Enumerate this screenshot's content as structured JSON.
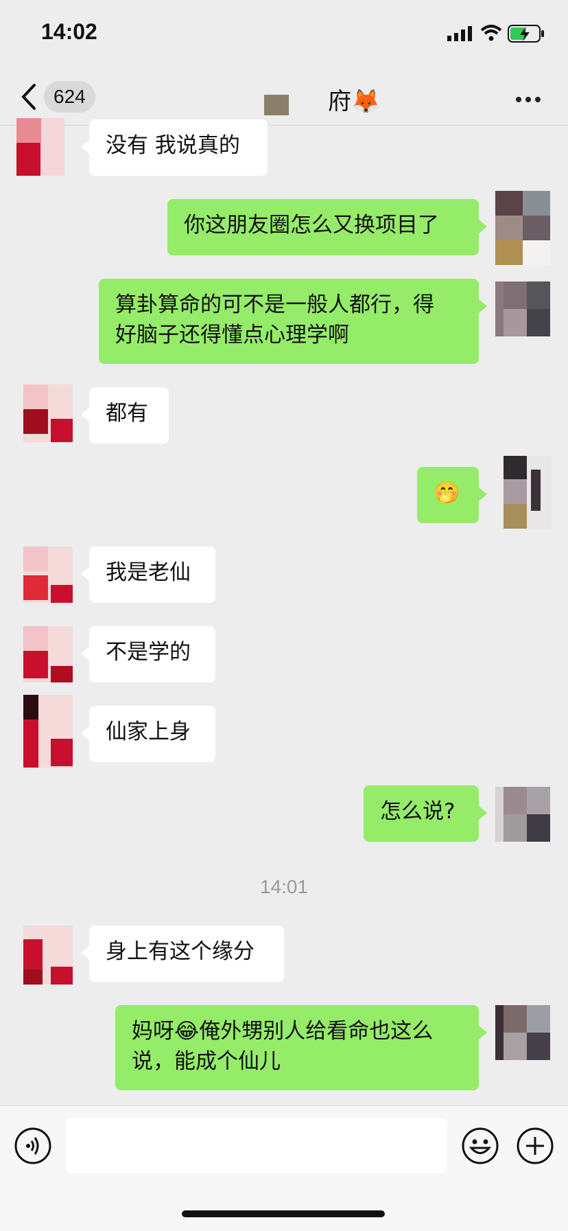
{
  "status_bar": {
    "time": "14:02"
  },
  "nav": {
    "unread_count": "624",
    "title": "府🦊"
  },
  "messages": [
    {
      "side": "left",
      "text": "没有 我说真的"
    },
    {
      "side": "right",
      "text": "你这朋友圈怎么又换项目了"
    },
    {
      "side": "right",
      "text": "算卦算命的可不是一般人都行，得\n好脑子还得懂点心理学啊"
    },
    {
      "side": "left",
      "text": "都有"
    },
    {
      "side": "right",
      "text": "🤭"
    },
    {
      "side": "left",
      "text": "我是老仙"
    },
    {
      "side": "left",
      "text": "不是学的"
    },
    {
      "side": "left",
      "text": "仙家上身"
    },
    {
      "side": "right",
      "text": "怎么说?"
    },
    {
      "side": "left",
      "text": "身上有这个缘分"
    },
    {
      "side": "right",
      "text": "妈呀😂俺外甥别人给看命也这么\n说，能成个仙儿"
    }
  ],
  "timestamp": "14:01",
  "colors": {
    "sent_bubble": "#95ec69",
    "received_bubble": "#ffffff",
    "background": "#ededed"
  },
  "icons": {
    "voice": "voice-icon",
    "emoji": "emoji-icon",
    "more": "plus-icon"
  }
}
